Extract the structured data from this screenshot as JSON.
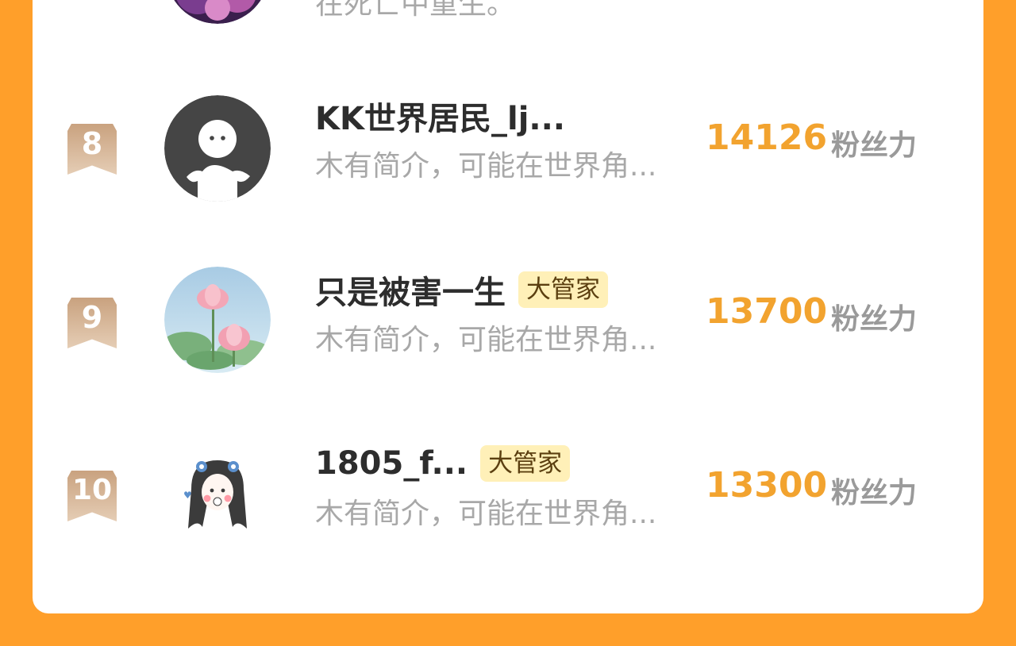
{
  "ranking": {
    "partial_top": {
      "desc": "在死亡中重生。"
    },
    "rows": [
      {
        "rank": "8",
        "nickname": "KK世界居民_lj...",
        "tag": "",
        "desc": "木有简介，可能在世界角...",
        "score": "14126",
        "score_unit": "粉丝力"
      },
      {
        "rank": "9",
        "nickname": "只是被害一生",
        "tag": "大管家",
        "desc": "木有简介，可能在世界角...",
        "score": "13700",
        "score_unit": "粉丝力"
      },
      {
        "rank": "10",
        "nickname": "1805_f...",
        "tag": "大管家",
        "desc": "木有简介，可能在世界角...",
        "score": "13300",
        "score_unit": "粉丝力"
      }
    ]
  },
  "colors": {
    "background": "#FF9F2A",
    "score_orange": "#F2A32F",
    "tag_bg": "#FFF0B8",
    "badge_gradient_top": "#c9a27f",
    "badge_gradient_bottom": "#e5cdb5"
  }
}
